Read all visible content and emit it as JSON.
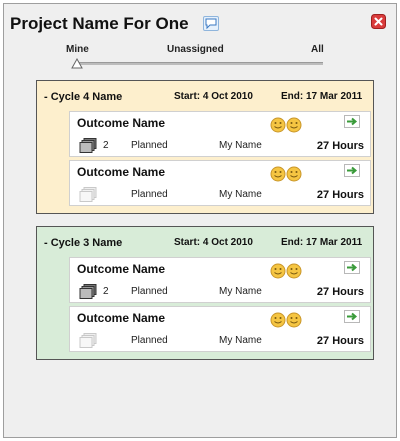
{
  "project": {
    "title": "Project Name For One"
  },
  "slider": {
    "left_label": "Mine",
    "middle_label": "Unassigned",
    "right_label": "All"
  },
  "icons": {
    "comment": "comment-icon",
    "close": "close-icon",
    "arrow": "arrow-right-icon",
    "smiley": "smiley-icon",
    "documents": "documents-icon"
  },
  "colors": {
    "cycle_4_bg": "#fdefcd",
    "cycle_3_bg": "#d8ecd8",
    "close_red": "#d93b3b",
    "arrow_green": "#3a9b3a",
    "smiley_gold": "#f5c542"
  },
  "cycles": [
    {
      "name": "- Cycle 4 Name",
      "start": "Start: 4 Oct 2010",
      "end": "End: 17 Mar 2011",
      "outcomes": [
        {
          "name": "Outcome Name",
          "count": "2",
          "status": "Planned",
          "owner": "My Name",
          "hours": "27 Hours",
          "has_docs": true
        },
        {
          "name": "Outcome Name",
          "count": "",
          "status": "Planned",
          "owner": "My Name",
          "hours": "27 Hours",
          "has_docs": false
        }
      ]
    },
    {
      "name": "- Cycle 3 Name",
      "start": "Start: 4 Oct 2010",
      "end": "End: 17 Mar 2011",
      "outcomes": [
        {
          "name": "Outcome Name",
          "count": "2",
          "status": "Planned",
          "owner": "My Name",
          "hours": "27 Hours",
          "has_docs": true
        },
        {
          "name": "Outcome Name",
          "count": "",
          "status": "Planned",
          "owner": "My Name",
          "hours": "27 Hours",
          "has_docs": false
        }
      ]
    }
  ]
}
